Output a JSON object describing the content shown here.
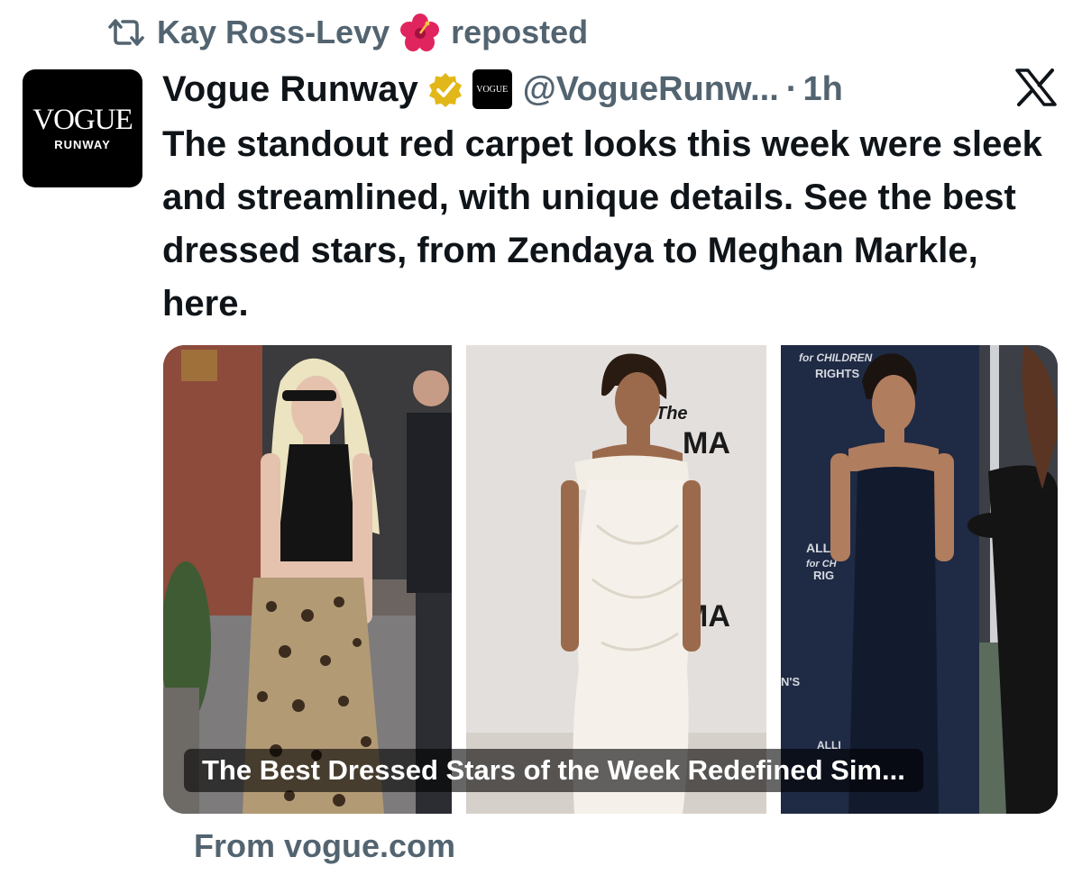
{
  "repost": {
    "icon": "repost-icon",
    "user": "Kay Ross-Levy",
    "emoji_icon": "hibiscus-icon",
    "action": "reposted"
  },
  "tweet": {
    "avatar": {
      "logo_line1": "VOGUE",
      "logo_line2": "RUNWAY"
    },
    "display_name": "Vogue Runway",
    "verified_icon": "verified-badge-icon",
    "affiliate_logo": "VOGUE",
    "handle": "@VogueRunw...",
    "separator": "·",
    "time": "1h",
    "platform_icon": "x-logo-icon",
    "text": "The standout red carpet looks this week were sleek and streamlined, with unique details. See the best dressed stars, from Zendaya to Meghan Markle, here."
  },
  "card": {
    "title": "The Best Dressed Stars of the Week Redefined Sim...",
    "source": "From vogue.com",
    "photos": [
      {
        "icon": "photo-street-style"
      },
      {
        "icon": "photo-white-gown",
        "backdrop_text": [
          "The",
          "MA",
          "MA"
        ]
      },
      {
        "icon": "photo-navy-gown",
        "backdrop_text": [
          "for CHILDREN",
          "RIGHTS",
          "ALLI",
          "for CH",
          "RIG",
          "N'S",
          "ALLI"
        ]
      }
    ]
  },
  "colors": {
    "text_primary": "#0f1419",
    "text_secondary": "#536471",
    "verified_gold": "#e2b719",
    "background": "#ffffff"
  }
}
